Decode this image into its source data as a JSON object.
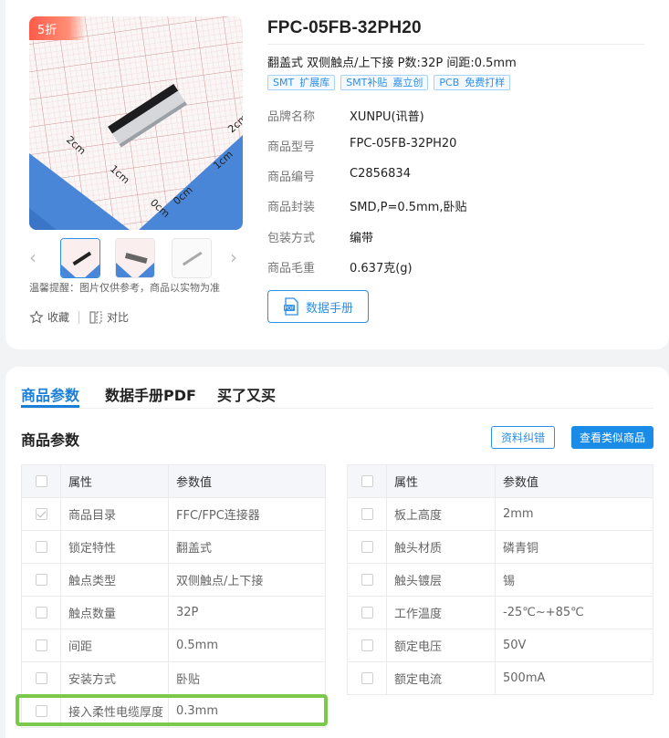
{
  "product": {
    "discount_badge": "5折",
    "title": "FPC-05FB-32PH20",
    "subtitle": "翻盖式 双侧触点/上下接 P数:32P 间距:0.5mm",
    "tags": [
      {
        "a": "SMT",
        "b": "扩展库"
      },
      {
        "a": "SMT补贴",
        "b": "嘉立创"
      },
      {
        "a": "PCB",
        "b": "免费打样"
      }
    ],
    "attributes": [
      {
        "k": "品牌名称",
        "v": "XUNPU(讯普)"
      },
      {
        "k": "商品型号",
        "v": "FPC-05FB-32PH20"
      },
      {
        "k": "商品编号",
        "v": "C2856834"
      },
      {
        "k": "商品封装",
        "v": "SMD,P=0.5mm,卧贴"
      },
      {
        "k": "包装方式",
        "v": "编带"
      },
      {
        "k": "商品毛重",
        "v": "0.637克(g)"
      }
    ],
    "datasheet_button": "数据手册",
    "image_note": "温馨提醒：图片仅供参考，商品以实物为准",
    "favorite_label": "收藏",
    "compare_label": "对比",
    "ruler_labels": [
      "2cm",
      "1cm",
      "0cm",
      "0cm",
      "1cm",
      "2cm"
    ]
  },
  "tabs": [
    "商品参数",
    "数据手册PDF",
    "买了又买"
  ],
  "params": {
    "section_title": "商品参数",
    "correct_button": "资料纠错",
    "similar_button": "查看类似商品",
    "header_attr": "属性",
    "header_value": "参数值",
    "left_rows": [
      {
        "attr": "商品目录",
        "value": "FFC/FPC连接器",
        "checked": true
      },
      {
        "attr": "锁定特性",
        "value": "翻盖式",
        "checked": false
      },
      {
        "attr": "触点类型",
        "value": "双侧触点/上下接",
        "checked": false
      },
      {
        "attr": "触点数量",
        "value": "32P",
        "checked": false
      },
      {
        "attr": "间距",
        "value": "0.5mm",
        "checked": false
      },
      {
        "attr": "安装方式",
        "value": "卧贴",
        "checked": false
      },
      {
        "attr": "接入柔性电缆厚度",
        "value": "0.3mm",
        "checked": false
      }
    ],
    "right_rows": [
      {
        "attr": "板上高度",
        "value": "2mm",
        "checked": false
      },
      {
        "attr": "触头材质",
        "value": "磷青铜",
        "checked": false
      },
      {
        "attr": "触头镀层",
        "value": "锡",
        "checked": false
      },
      {
        "attr": "工作温度",
        "value": "-25℃~+85℃",
        "checked": false
      },
      {
        "attr": "额定电压",
        "value": "50V",
        "checked": false
      },
      {
        "attr": "额定电流",
        "value": "500mA",
        "checked": false
      }
    ]
  },
  "colors": {
    "accent": "#1a8be6",
    "highlight": "#7bc94a",
    "badge": "#ff5b4a"
  }
}
